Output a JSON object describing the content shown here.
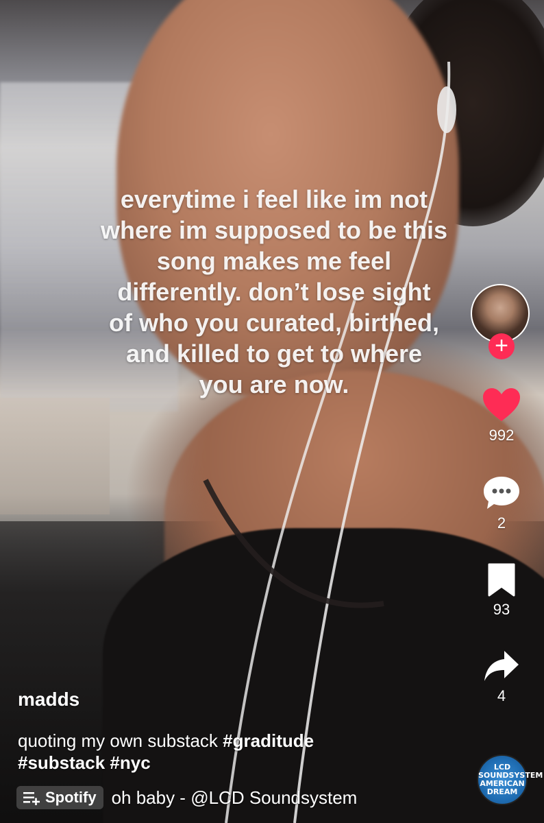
{
  "overlay": {
    "caption": "everytime i feel like im not\nwhere im supposed to be this\nsong makes me feel\ndifferently. don’t lose sight\nof who you curated, birthed,\nand killed to get to where\nyou are now."
  },
  "rail": {
    "follow_label": "+",
    "like_count": "992",
    "comment_count": "2",
    "save_count": "93",
    "share_count": "4"
  },
  "post": {
    "username": "madds",
    "description_text": "quoting my own substack",
    "tags": [
      "#graditude",
      "#substack",
      "#nyc"
    ]
  },
  "music": {
    "provider": "Spotify",
    "title": "oh baby - @LCD Soundsystem",
    "album_lines": [
      "LCD",
      "SOUNDSYSTEM",
      "AMERICAN",
      "DREAM"
    ]
  },
  "colors": {
    "like": "#fe2c55",
    "follow": "#fe2c55",
    "album": "#1f6db3"
  },
  "icons": {
    "like": "heart-icon",
    "comment": "comment-bubble-icon",
    "save": "bookmark-icon",
    "share": "share-arrow-icon",
    "music_chip": "add-to-playlist-icon"
  }
}
